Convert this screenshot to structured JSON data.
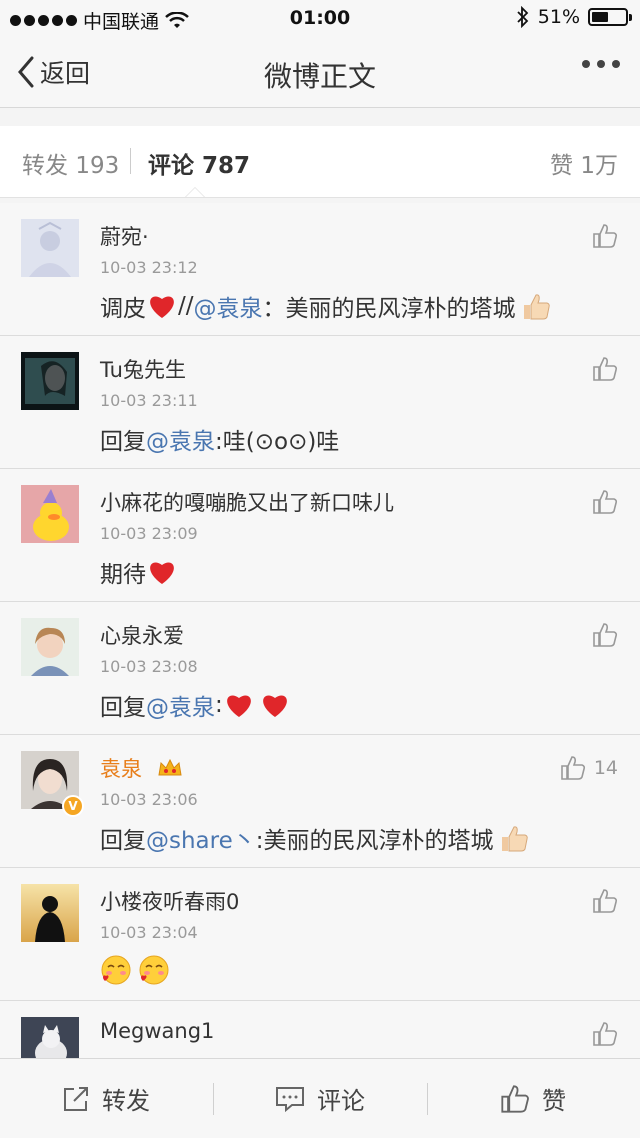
{
  "status_bar": {
    "carrier": "中国联通",
    "time": "01:00",
    "battery_text": "51%",
    "battery_level": 0.51
  },
  "nav": {
    "back_label": "返回",
    "title": "微博正文"
  },
  "tabs": {
    "repost_label": "转发",
    "repost_count": "193",
    "comment_label": "评论",
    "comment_count": "787",
    "like_label": "赞",
    "like_count": "1万"
  },
  "comments": [
    {
      "name": "蔚宛·",
      "time": "10-03 23:12",
      "text_parts": [
        "调皮",
        "//",
        "@袁泉",
        "：美丽的民风淳朴的塔城"
      ]
    },
    {
      "name": "Tu兔先生",
      "time": "10-03 23:11",
      "text_parts": [
        "回复",
        "@袁泉",
        ":哇(⊙o⊙)哇"
      ]
    },
    {
      "name": "小麻花的嘎嘣脆又出了新口味儿",
      "time": "10-03 23:09",
      "text_parts": [
        "期待"
      ]
    },
    {
      "name": "心泉永爱",
      "time": "10-03 23:08",
      "text_parts": [
        "回复",
        "@袁泉",
        ":"
      ]
    },
    {
      "name": "袁泉",
      "time": "10-03 23:06",
      "like_count": "14",
      "text_parts": [
        "回复",
        "@share丶",
        ":美丽的民风淳朴的塔城"
      ]
    },
    {
      "name": "小楼夜听春雨0",
      "time": "10-03 23:04"
    },
    {
      "name": "Megwang1"
    }
  ],
  "bottom_bar": {
    "repost_label": "转发",
    "comment_label": "评论",
    "like_label": "赞"
  },
  "colors": {
    "mention": "#4a76b0",
    "vip_name": "#e87e1a",
    "heart": "#e0262a",
    "verified_badge": "#f5a623"
  }
}
